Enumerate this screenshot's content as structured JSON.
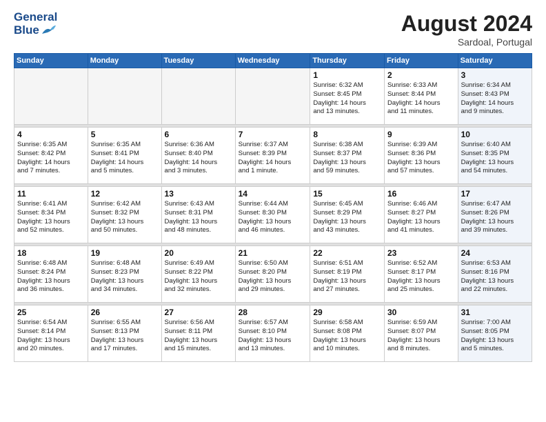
{
  "header": {
    "logo_line1": "General",
    "logo_line2": "Blue",
    "month": "August 2024",
    "location": "Sardoal, Portugal"
  },
  "weekdays": [
    "Sunday",
    "Monday",
    "Tuesday",
    "Wednesday",
    "Thursday",
    "Friday",
    "Saturday"
  ],
  "weeks": [
    [
      {
        "day": "",
        "info": ""
      },
      {
        "day": "",
        "info": ""
      },
      {
        "day": "",
        "info": ""
      },
      {
        "day": "",
        "info": ""
      },
      {
        "day": "1",
        "info": "Sunrise: 6:32 AM\nSunset: 8:45 PM\nDaylight: 14 hours\nand 13 minutes."
      },
      {
        "day": "2",
        "info": "Sunrise: 6:33 AM\nSunset: 8:44 PM\nDaylight: 14 hours\nand 11 minutes."
      },
      {
        "day": "3",
        "info": "Sunrise: 6:34 AM\nSunset: 8:43 PM\nDaylight: 14 hours\nand 9 minutes."
      }
    ],
    [
      {
        "day": "4",
        "info": "Sunrise: 6:35 AM\nSunset: 8:42 PM\nDaylight: 14 hours\nand 7 minutes."
      },
      {
        "day": "5",
        "info": "Sunrise: 6:35 AM\nSunset: 8:41 PM\nDaylight: 14 hours\nand 5 minutes."
      },
      {
        "day": "6",
        "info": "Sunrise: 6:36 AM\nSunset: 8:40 PM\nDaylight: 14 hours\nand 3 minutes."
      },
      {
        "day": "7",
        "info": "Sunrise: 6:37 AM\nSunset: 8:39 PM\nDaylight: 14 hours\nand 1 minute."
      },
      {
        "day": "8",
        "info": "Sunrise: 6:38 AM\nSunset: 8:37 PM\nDaylight: 13 hours\nand 59 minutes."
      },
      {
        "day": "9",
        "info": "Sunrise: 6:39 AM\nSunset: 8:36 PM\nDaylight: 13 hours\nand 57 minutes."
      },
      {
        "day": "10",
        "info": "Sunrise: 6:40 AM\nSunset: 8:35 PM\nDaylight: 13 hours\nand 54 minutes."
      }
    ],
    [
      {
        "day": "11",
        "info": "Sunrise: 6:41 AM\nSunset: 8:34 PM\nDaylight: 13 hours\nand 52 minutes."
      },
      {
        "day": "12",
        "info": "Sunrise: 6:42 AM\nSunset: 8:32 PM\nDaylight: 13 hours\nand 50 minutes."
      },
      {
        "day": "13",
        "info": "Sunrise: 6:43 AM\nSunset: 8:31 PM\nDaylight: 13 hours\nand 48 minutes."
      },
      {
        "day": "14",
        "info": "Sunrise: 6:44 AM\nSunset: 8:30 PM\nDaylight: 13 hours\nand 46 minutes."
      },
      {
        "day": "15",
        "info": "Sunrise: 6:45 AM\nSunset: 8:29 PM\nDaylight: 13 hours\nand 43 minutes."
      },
      {
        "day": "16",
        "info": "Sunrise: 6:46 AM\nSunset: 8:27 PM\nDaylight: 13 hours\nand 41 minutes."
      },
      {
        "day": "17",
        "info": "Sunrise: 6:47 AM\nSunset: 8:26 PM\nDaylight: 13 hours\nand 39 minutes."
      }
    ],
    [
      {
        "day": "18",
        "info": "Sunrise: 6:48 AM\nSunset: 8:24 PM\nDaylight: 13 hours\nand 36 minutes."
      },
      {
        "day": "19",
        "info": "Sunrise: 6:48 AM\nSunset: 8:23 PM\nDaylight: 13 hours\nand 34 minutes."
      },
      {
        "day": "20",
        "info": "Sunrise: 6:49 AM\nSunset: 8:22 PM\nDaylight: 13 hours\nand 32 minutes."
      },
      {
        "day": "21",
        "info": "Sunrise: 6:50 AM\nSunset: 8:20 PM\nDaylight: 13 hours\nand 29 minutes."
      },
      {
        "day": "22",
        "info": "Sunrise: 6:51 AM\nSunset: 8:19 PM\nDaylight: 13 hours\nand 27 minutes."
      },
      {
        "day": "23",
        "info": "Sunrise: 6:52 AM\nSunset: 8:17 PM\nDaylight: 13 hours\nand 25 minutes."
      },
      {
        "day": "24",
        "info": "Sunrise: 6:53 AM\nSunset: 8:16 PM\nDaylight: 13 hours\nand 22 minutes."
      }
    ],
    [
      {
        "day": "25",
        "info": "Sunrise: 6:54 AM\nSunset: 8:14 PM\nDaylight: 13 hours\nand 20 minutes."
      },
      {
        "day": "26",
        "info": "Sunrise: 6:55 AM\nSunset: 8:13 PM\nDaylight: 13 hours\nand 17 minutes."
      },
      {
        "day": "27",
        "info": "Sunrise: 6:56 AM\nSunset: 8:11 PM\nDaylight: 13 hours\nand 15 minutes."
      },
      {
        "day": "28",
        "info": "Sunrise: 6:57 AM\nSunset: 8:10 PM\nDaylight: 13 hours\nand 13 minutes."
      },
      {
        "day": "29",
        "info": "Sunrise: 6:58 AM\nSunset: 8:08 PM\nDaylight: 13 hours\nand 10 minutes."
      },
      {
        "day": "30",
        "info": "Sunrise: 6:59 AM\nSunset: 8:07 PM\nDaylight: 13 hours\nand 8 minutes."
      },
      {
        "day": "31",
        "info": "Sunrise: 7:00 AM\nSunset: 8:05 PM\nDaylight: 13 hours\nand 5 minutes."
      }
    ]
  ]
}
